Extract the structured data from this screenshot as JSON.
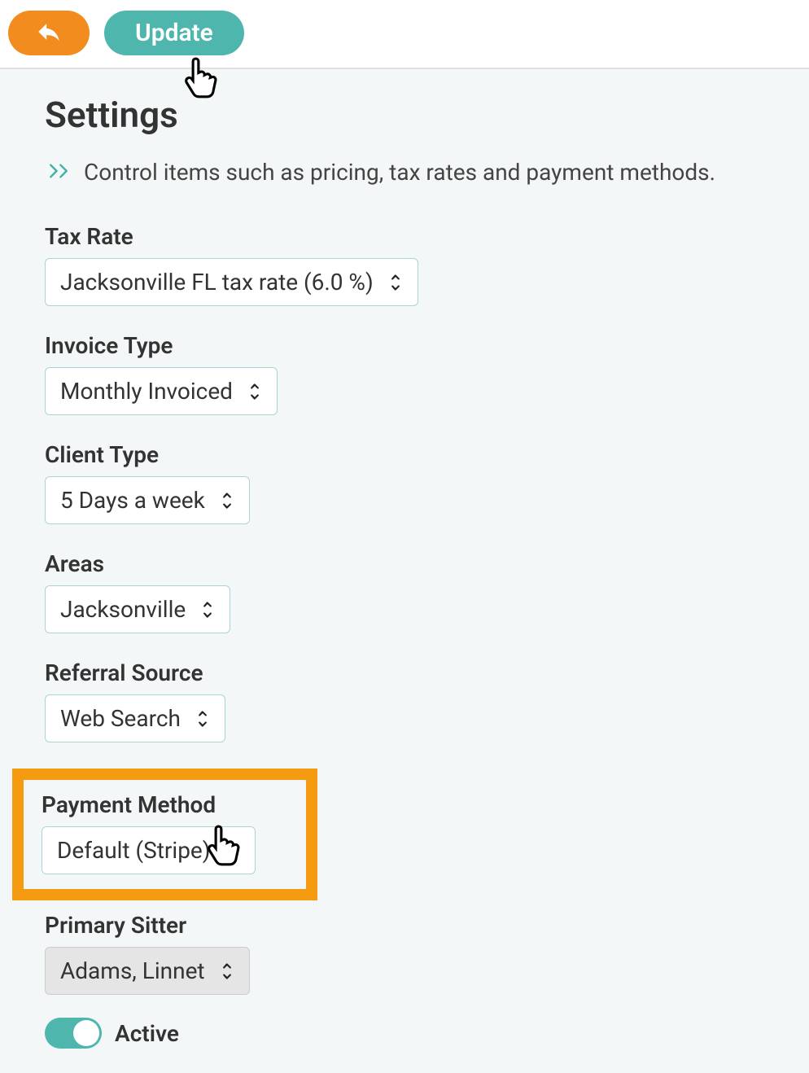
{
  "toolbar": {
    "update_label": "Update"
  },
  "page": {
    "title": "Settings",
    "description": "Control items such as pricing, tax rates and payment methods."
  },
  "fields": {
    "tax_rate": {
      "label": "Tax Rate",
      "value": "Jacksonville FL tax rate (6.0 %)"
    },
    "invoice_type": {
      "label": "Invoice Type",
      "value": "Monthly Invoiced"
    },
    "client_type": {
      "label": "Client Type",
      "value": "5 Days a week"
    },
    "areas": {
      "label": "Areas",
      "value": "Jacksonville"
    },
    "referral_source": {
      "label": "Referral Source",
      "value": "Web Search"
    },
    "payment_method": {
      "label": "Payment Method",
      "value": "Default (Stripe)"
    },
    "primary_sitter": {
      "label": "Primary Sitter",
      "value": "Adams, Linnet"
    }
  },
  "toggle": {
    "active_label": "Active",
    "state": true
  },
  "colors": {
    "accent_teal": "#4eb6ac",
    "accent_orange": "#f28c1e",
    "highlight": "#f49b12"
  }
}
